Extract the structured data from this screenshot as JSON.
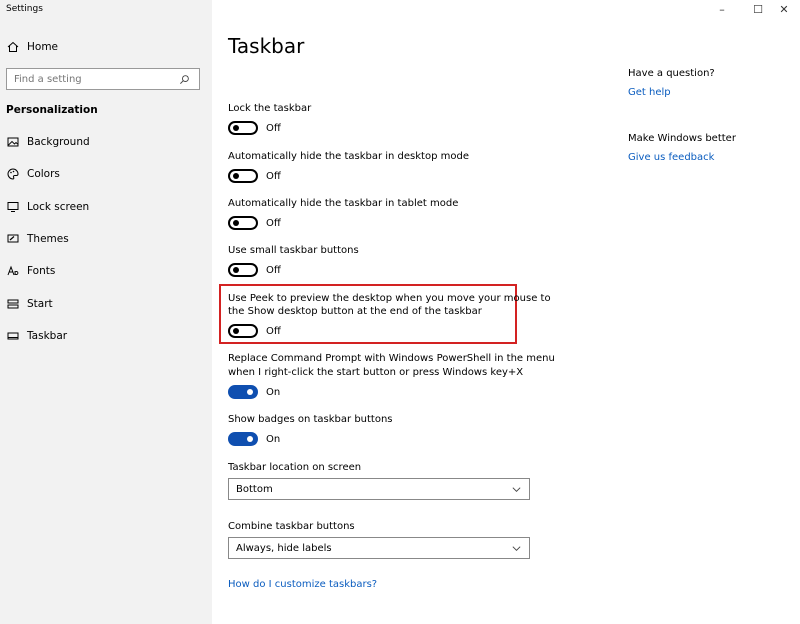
{
  "window": {
    "title": "Settings",
    "minimize_glyph": "–",
    "maximize_glyph": "☐",
    "close_glyph": "✕"
  },
  "sidebar": {
    "home_label": "Home",
    "search_placeholder": "Find a setting",
    "section_title": "Personalization",
    "items": [
      {
        "label": "Background",
        "icon": "image-icon"
      },
      {
        "label": "Colors",
        "icon": "palette-icon"
      },
      {
        "label": "Lock screen",
        "icon": "monitor-icon"
      },
      {
        "label": "Themes",
        "icon": "brush-icon"
      },
      {
        "label": "Fonts",
        "icon": "font-icon"
      },
      {
        "label": "Start",
        "icon": "start-grid-icon"
      },
      {
        "label": "Taskbar",
        "icon": "taskbar-icon"
      }
    ]
  },
  "main": {
    "title": "Taskbar",
    "settings": [
      {
        "label": "Lock the taskbar",
        "state": "Off"
      },
      {
        "label": "Automatically hide the taskbar in desktop mode",
        "state": "Off"
      },
      {
        "label": "Automatically hide the taskbar in tablet mode",
        "state": "Off"
      },
      {
        "label": "Use small taskbar buttons",
        "state": "Off"
      },
      {
        "label_line1": "Use Peek to preview the desktop when you move your mouse to",
        "label_line2": "the Show desktop button at the end of the taskbar",
        "state": "Off"
      },
      {
        "label_line1": "Replace Command Prompt with Windows PowerShell in the menu",
        "label_line2": "when I right-click the start button or press Windows key+X",
        "state": "On"
      },
      {
        "label": "Show badges on taskbar buttons",
        "state": "On"
      }
    ],
    "location_label": "Taskbar location on screen",
    "location_value": "Bottom",
    "combine_label": "Combine taskbar buttons",
    "combine_value": "Always, hide labels",
    "help_link": "How do I customize taskbars?"
  },
  "aside": {
    "question_title": "Have a question?",
    "get_help": "Get help",
    "better_title": "Make Windows better",
    "feedback": "Give us feedback"
  },
  "colors": {
    "accent": "#0f4fb0",
    "link": "#0a5cbf",
    "highlight_border": "#d32222",
    "sidebar_bg": "#f2f2f2"
  }
}
